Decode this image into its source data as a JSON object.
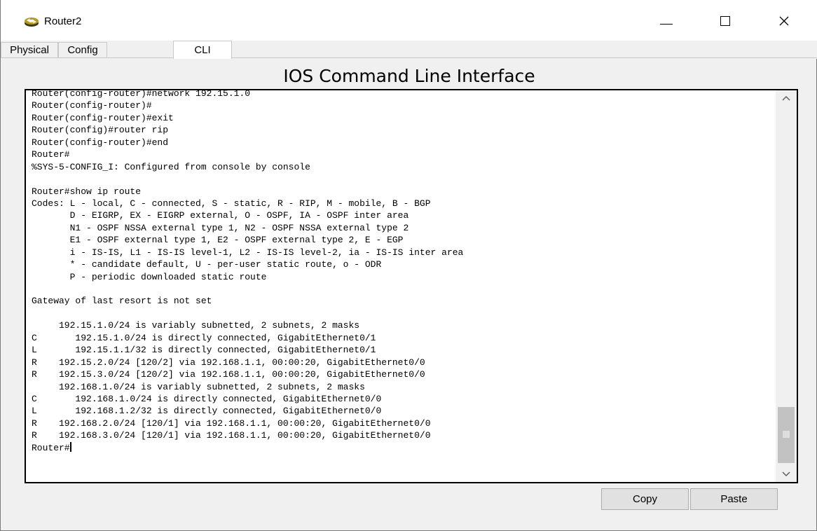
{
  "window": {
    "title": "Router2",
    "icon": "router-icon",
    "minimize_glyph": "",
    "close_glyph": "✕"
  },
  "tabs": [
    {
      "label": "Physical",
      "active": false
    },
    {
      "label": "Config",
      "active": false
    },
    {
      "label": "CLI",
      "active": true
    }
  ],
  "cli": {
    "heading": "IOS Command Line Interface",
    "prompt": "Router#",
    "lines": [
      "Router(config-router)#network 192.15.1.0",
      "Router(config-router)#",
      "Router(config-router)#exit",
      "Router(config)#router rip",
      "Router(config-router)#end",
      "Router#",
      "%SYS-5-CONFIG_I: Configured from console by console",
      "",
      "Router#show ip route",
      "Codes: L - local, C - connected, S - static, R - RIP, M - mobile, B - BGP",
      "       D - EIGRP, EX - EIGRP external, O - OSPF, IA - OSPF inter area",
      "       N1 - OSPF NSSA external type 1, N2 - OSPF NSSA external type 2",
      "       E1 - OSPF external type 1, E2 - OSPF external type 2, E - EGP",
      "       i - IS-IS, L1 - IS-IS level-1, L2 - IS-IS level-2, ia - IS-IS inter area",
      "       * - candidate default, U - per-user static route, o - ODR",
      "       P - periodic downloaded static route",
      "",
      "Gateway of last resort is not set",
      "",
      "     192.15.1.0/24 is variably subnetted, 2 subnets, 2 masks",
      "C       192.15.1.0/24 is directly connected, GigabitEthernet0/1",
      "L       192.15.1.1/32 is directly connected, GigabitEthernet0/1",
      "R    192.15.2.0/24 [120/2] via 192.168.1.1, 00:00:20, GigabitEthernet0/0",
      "R    192.15.3.0/24 [120/2] via 192.168.1.1, 00:00:20, GigabitEthernet0/0",
      "     192.168.1.0/24 is variably subnetted, 2 subnets, 2 masks",
      "C       192.168.1.0/24 is directly connected, GigabitEthernet0/0",
      "L       192.168.1.2/32 is directly connected, GigabitEthernet0/0",
      "R    192.168.2.0/24 [120/1] via 192.168.1.1, 00:00:20, GigabitEthernet0/0",
      "R    192.168.3.0/24 [120/1] via 192.168.1.1, 00:00:20, GigabitEthernet0/0"
    ]
  },
  "buttons": {
    "copy": "Copy",
    "paste": "Paste"
  },
  "colors": {
    "window_bg": "#f0f0f0",
    "terminal_bg": "#ffffff",
    "terminal_border": "#000000",
    "button_bg": "#e1e1e1"
  }
}
